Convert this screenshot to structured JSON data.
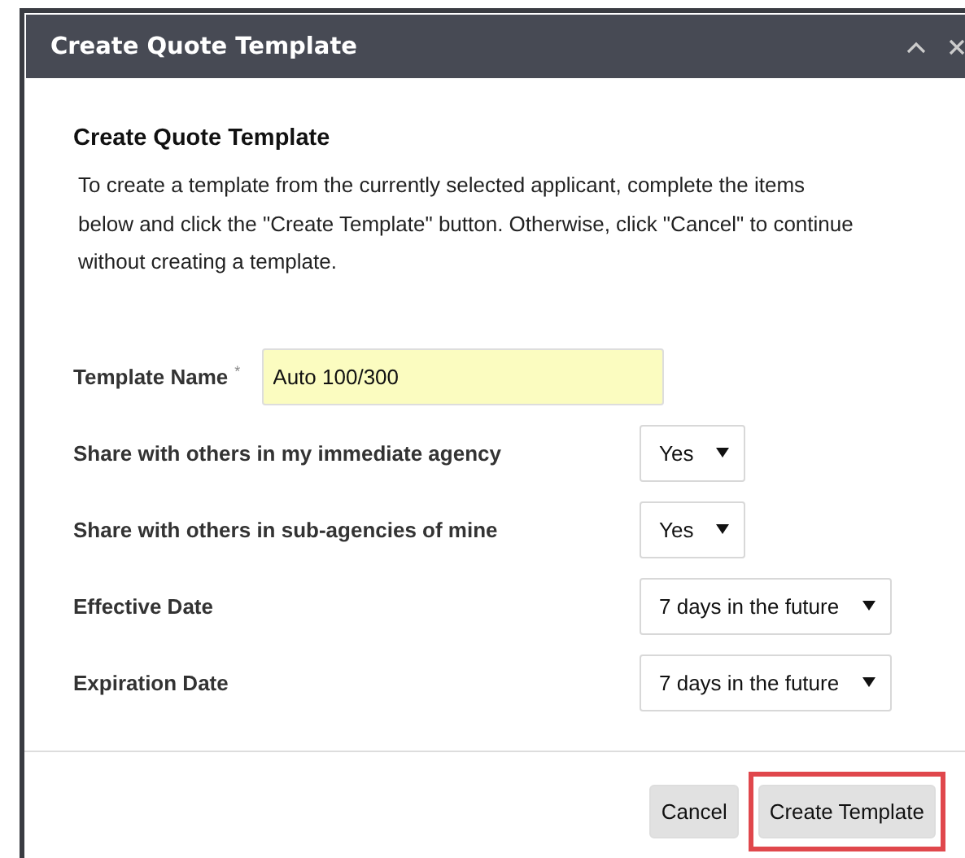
{
  "window": {
    "title": "Create Quote Template"
  },
  "heading": "Create Quote Template",
  "intro": "To create a template from the currently selected applicant, complete the items below and click the \"Create Template\" button. Otherwise, click \"Cancel\" to continue without creating a template.",
  "fields": [
    {
      "kind": "text",
      "label": "Template Name",
      "required_mark": "*",
      "value": "Auto 100/300"
    },
    {
      "kind": "select",
      "label": "Share with others in my immediate agency",
      "value": "Yes"
    },
    {
      "kind": "select",
      "label": "Share with others in sub-agencies of mine",
      "value": "Yes"
    },
    {
      "kind": "select",
      "label": "Effective Date",
      "value": "7 days in the future"
    },
    {
      "kind": "select",
      "label": "Expiration Date",
      "value": "7 days in the future"
    }
  ],
  "buttons": [
    {
      "label": "Cancel",
      "highlighted": false
    },
    {
      "label": "Create Template",
      "highlighted": true
    }
  ]
}
